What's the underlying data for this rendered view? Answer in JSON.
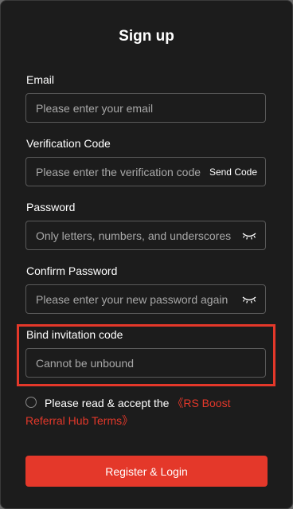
{
  "dialog": {
    "title": "Sign up"
  },
  "email": {
    "label": "Email",
    "placeholder": "Please enter your email",
    "value": ""
  },
  "verification": {
    "label": "Verification Code",
    "placeholder": "Please enter the verification code",
    "value": "",
    "send_code_label": "Send Code"
  },
  "password": {
    "label": "Password",
    "placeholder": "Only letters, numbers, and underscores",
    "value": "",
    "icon": "eye-closed-icon"
  },
  "confirm_password": {
    "label": "Confirm Password",
    "placeholder": "Please enter your new password again",
    "value": "",
    "icon": "eye-closed-icon"
  },
  "invitation": {
    "label": "Bind invitation code",
    "placeholder": "Cannot be unbound",
    "value": ""
  },
  "agreement": {
    "text": "Please read & accept the",
    "link_part1": "《RS Boost",
    "link_part2": "Referral Hub Terms》",
    "checked": false
  },
  "register_button": {
    "label": "Register & Login"
  },
  "colors": {
    "accent": "#e4382a",
    "background": "#1c1c1c",
    "border": "#5a5a5a"
  }
}
